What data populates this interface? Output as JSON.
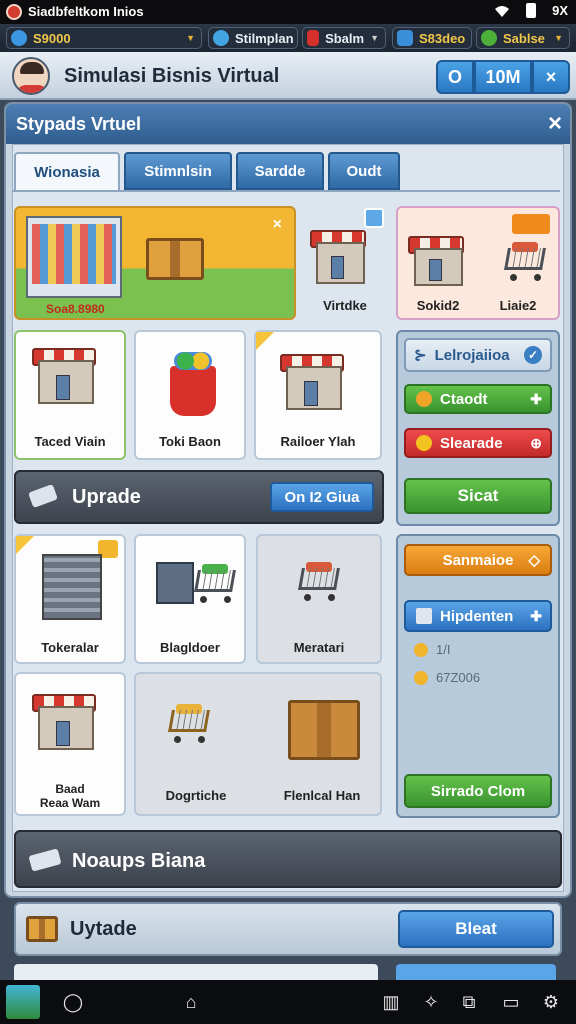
{
  "status_bar": {
    "title": "Siadbfeltkom Inios",
    "battery": "9X"
  },
  "resources": [
    {
      "value": "S9000",
      "icon": "check-badge-icon",
      "color": "#3d96e0"
    },
    {
      "value": "Stilmplan",
      "icon": "globe-icon",
      "color": "#42a4e0"
    },
    {
      "value": "Sbalm",
      "icon": "red-box-icon",
      "color": "#d6302c"
    },
    {
      "value": "S83deo",
      "icon": "blue-box-icon",
      "color": "#3b8fd9"
    },
    {
      "value": "Sablse",
      "icon": "green-gear-icon",
      "color": "#4caf3a"
    }
  ],
  "header": {
    "title": "Simulasi Bisnis Virtual",
    "btn_o": "O",
    "btn_10m": "10M",
    "close": "×"
  },
  "panel": {
    "title": "Stypads Vrtuel",
    "close": "×"
  },
  "tabs": [
    "Wionasia",
    "Stimnlsin",
    "Sardde",
    "Oudt"
  ],
  "hero": {
    "price": "Soa8.8980",
    "close": "×"
  },
  "top_cards": [
    {
      "label": "Virtdke"
    },
    {
      "label": "Sokid2"
    },
    {
      "label": "Liaie2"
    }
  ],
  "row1": [
    {
      "label": "Taced Viain"
    },
    {
      "label": "Toki Baon"
    },
    {
      "label": "Railoer Ylah"
    }
  ],
  "upgrade_bar": {
    "title": "Uprade",
    "button": "On I2 Giua"
  },
  "side_top": {
    "title": "Lelrojaiioa",
    "buttons": [
      {
        "label": "Ctaodt",
        "style": "green"
      },
      {
        "label": "Slearade",
        "style": "red"
      },
      {
        "label": "Sicat",
        "style": "green"
      }
    ]
  },
  "row2": [
    {
      "label": "Tokeralar"
    },
    {
      "label": "Blagldoer"
    },
    {
      "label": "Meratari"
    }
  ],
  "row3": [
    {
      "label1": "Baad",
      "label2": "Reaa Wam"
    },
    {
      "label": "Dogrtiche"
    },
    {
      "label": "Flenlcal Han"
    }
  ],
  "side_bottom": {
    "top_button": "Sanmaioe",
    "hire_button": "Hipdenten",
    "stat1": "1/I",
    "stat2": "67Z006",
    "bottom_button": "Sirrado Clom"
  },
  "noups_bar": {
    "title": "Noaups Biana"
  },
  "uytade_bar": {
    "title": "Uytade",
    "button": "Bleat"
  }
}
